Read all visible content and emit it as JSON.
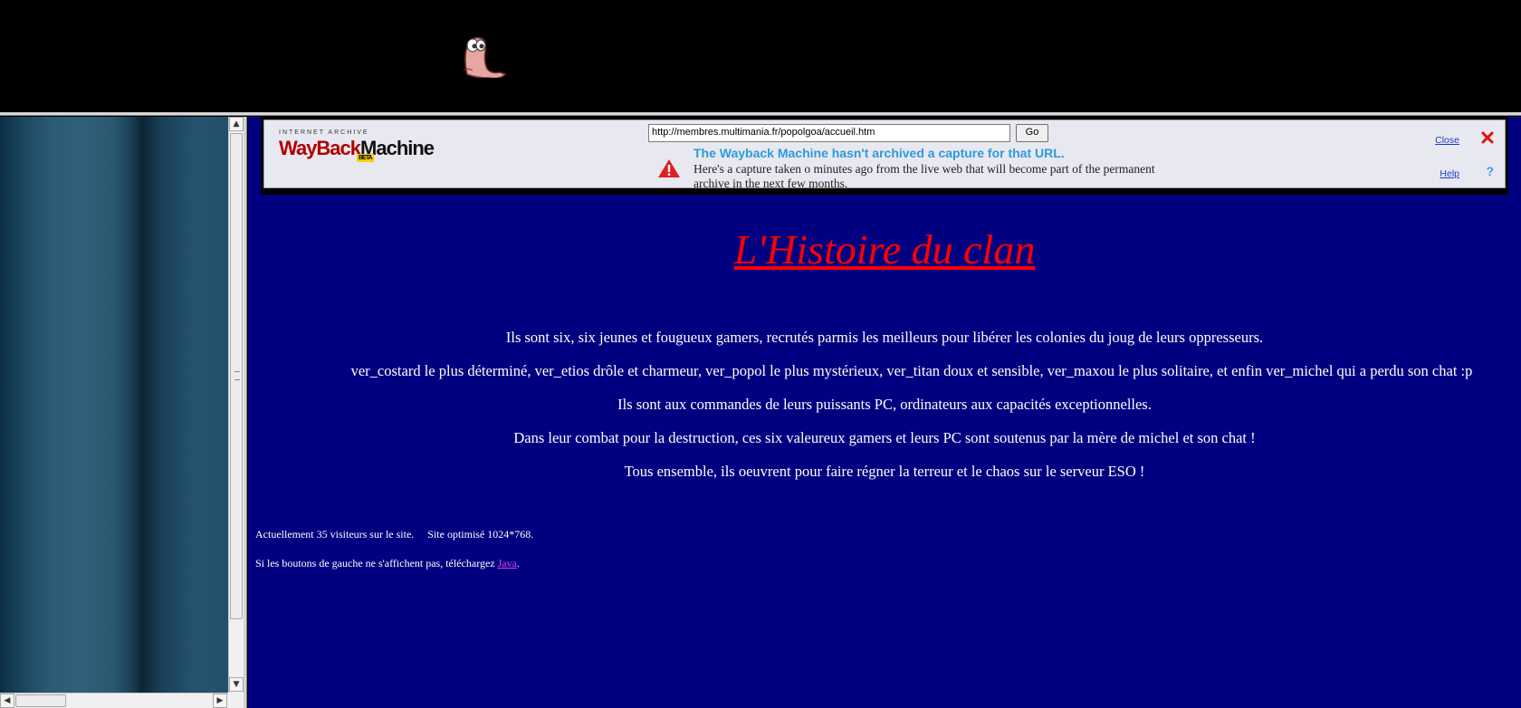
{
  "wayback": {
    "logo_top": "INTERNET ARCHIVE",
    "logo_wayback": "WayBack",
    "logo_machine": "Machine",
    "logo_beta": "BETA",
    "url_value": "http://membres.multimania.fr/popolgoa/accueil.htm",
    "go_label": "Go",
    "headline": "The Wayback Machine hasn't archived a capture for that URL.",
    "subtext": "Here's a capture taken o minutes ago from the live web that will become part of the permanent archive in the next few months.",
    "close_label": "Close",
    "help_label": "Help",
    "help_glyph": "?"
  },
  "page": {
    "title": "L'Histoire du clan",
    "paragraphs": [
      "Ils sont six, six jeunes et fougueux gamers, recrutés parmis les meilleurs pour libérer les colonies du joug de leurs oppresseurs.",
      "ver_costard le plus déterminé, ver_etios drôle et charmeur, ver_popol le plus mystérieux, ver_titan doux et sensible, ver_maxou le plus solitaire, et enfin ver_michel qui a perdu son chat :p",
      "Ils sont aux commandes de leurs puissants PC, ordinateurs aux capacités exceptionnelles.",
      "Dans leur combat pour la destruction, ces six valeureux gamers et leurs PC  sont soutenus par la mère de michel et son chat !",
      "Tous ensemble, ils oeuvrent pour faire régner la terreur et le chaos sur le serveur ESO !"
    ],
    "visitors": "Actuellement 35 visiteurs sur le site.",
    "optimized": "Site optimisé 1024*768.",
    "java_prefix": "Si les boutons de gauche ne s'affichent pas, téléchargez ",
    "java_link": "Java",
    "java_suffix": "."
  },
  "colors": {
    "main_bg": "#000080",
    "title": "#ff0000",
    "text": "#ffffff",
    "link": "#e040e0",
    "wayback_headline": "#2d9bd8"
  },
  "icons": {
    "banner": "worm-icon",
    "warning": "warning-icon",
    "close": "close-icon",
    "help": "help-icon"
  }
}
